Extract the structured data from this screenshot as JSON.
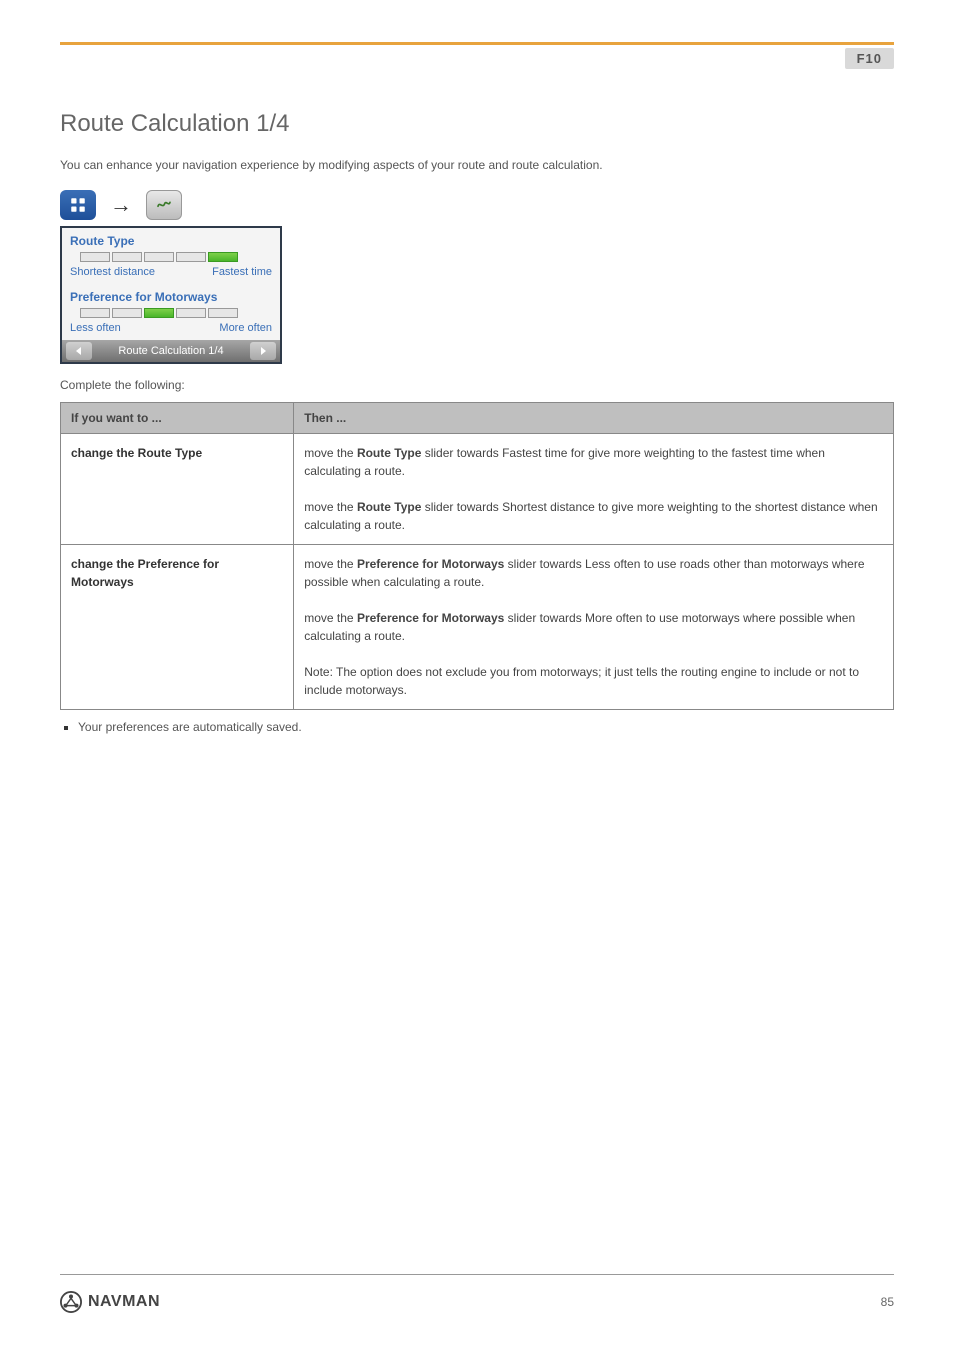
{
  "badge": "F10",
  "heading": "Route Calculation 1/4",
  "intro": "You can enhance your navigation experience by modifying aspects of your route and route calculation.",
  "screenshot": {
    "sec1_label": "Route Type",
    "sec1_min": "Shortest distance",
    "sec1_max": "Fastest time",
    "sec2_label": "Preference for Motorways",
    "sec2_min": "Less often",
    "sec2_max": "More often",
    "footer_text": "Route Calculation 1/4"
  },
  "help_text": "Complete the following:",
  "table": {
    "h1": "If you want to ...",
    "h2": "Then ...",
    "rows": [
      {
        "left": "change the Route Type",
        "right_pre": "move the ",
        "right_bold": "Route Type",
        "right_post": " slider towards Fastest time for give more weighting to the fastest time when calculating a route.",
        "right2_pre": "move the ",
        "right2_bold": "Route Type",
        "right2_post": " slider towards Shortest distance to give more weighting to the shortest distance when calculating a route."
      },
      {
        "left": "change the Preference for Motorways",
        "right_pre": "move the ",
        "right_bold": "Preference for Motorways",
        "right_post": " slider towards Less often to use roads other than motorways where possible when calculating a route.",
        "right2_pre": "move the ",
        "right2_bold": "Preference for Motorways",
        "right2_post": " slider towards More often to use motorways where possible when calculating a route.",
        "note": "Note: The option does not exclude you from motorways; it just tells the routing engine to include or not to include motorways."
      }
    ]
  },
  "footnote": "Your preferences are automatically saved.",
  "brand": "NAVMAN",
  "page_number": "85"
}
